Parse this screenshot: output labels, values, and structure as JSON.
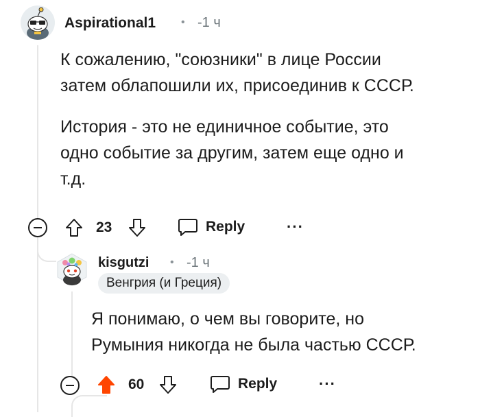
{
  "comment1": {
    "username": "Aspirational1",
    "time": "-1 ч",
    "paragraphs": [
      "К сожалению, \"союзники\" в лице России",
      "затем облапошили их, присоединив к СССР.",
      "История - это не единичное событие, это",
      "одно событие за другим, затем еще одно и",
      "т.д."
    ],
    "score": "23",
    "reply_label": "Reply",
    "more_label": "···",
    "upvoted": false
  },
  "comment2": {
    "username": "kisgutzi",
    "time": "-1 ч",
    "flair": "Венгрия (и Греция)",
    "paragraphs": [
      "Я понимаю, о чем вы говорите, но",
      "Румыния никогда не была частью СССР."
    ],
    "score": "60",
    "reply_label": "Reply",
    "more_label": "···",
    "upvoted": true
  },
  "colors": {
    "upvote_active": "#ff4500",
    "thread_line": "#e6e6e6",
    "meta_text": "#6b7479",
    "flair_bg": "#eceff1"
  },
  "icons": {
    "avatar1": "snoo-avatar-icon",
    "avatar2": "snoo-avatar-hex-icon",
    "collapse": "collapse-minus-icon",
    "upvote": "arrow-up-icon",
    "downvote": "arrow-down-icon",
    "reply": "speech-bubble-icon",
    "more": "more-dots-icon"
  }
}
